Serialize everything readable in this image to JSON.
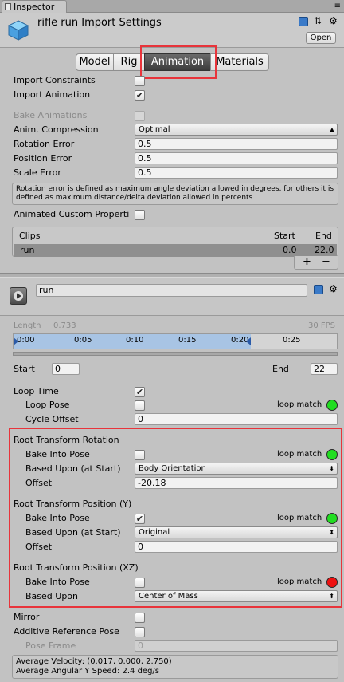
{
  "window": {
    "tab_label": "Inspector"
  },
  "header": {
    "title": "rifle run Import Settings",
    "open_button": "Open"
  },
  "tabs": [
    {
      "label": "Model"
    },
    {
      "label": "Rig"
    },
    {
      "label": "Animation",
      "active": true
    },
    {
      "label": "Materials"
    }
  ],
  "import": {
    "constraints_label": "Import Constraints",
    "constraints_checked": false,
    "animation_label": "Import Animation",
    "animation_checked": true,
    "bake_label": "Bake Animations",
    "bake_checked": false,
    "compression_label": "Anim. Compression",
    "compression_value": "Optimal",
    "rotation_error_label": "Rotation Error",
    "rotation_error_value": "0.5",
    "position_error_label": "Position Error",
    "position_error_value": "0.5",
    "scale_error_label": "Scale Error",
    "scale_error_value": "0.5",
    "help_text": "Rotation error is defined as maximum angle deviation allowed in degrees, for others it is defined as maximum distance/delta deviation allowed in percents",
    "custom_props_label": "Animated Custom Properti",
    "custom_props_checked": false
  },
  "clips": {
    "headers": {
      "name": "Clips",
      "start": "Start",
      "end": "End"
    },
    "rows": [
      {
        "name": "run",
        "start": "0.0",
        "end": "22.0"
      }
    ],
    "add": "+",
    "remove": "−"
  },
  "clip": {
    "name": "run",
    "length_label": "Length",
    "length_value": "0.733",
    "fps": "30 FPS",
    "timeline_ticks": [
      "0:00",
      "0:05",
      "0:10",
      "0:15",
      "0:20",
      "0:25"
    ],
    "start_label": "Start",
    "start_value": "0",
    "end_label": "End",
    "end_value": "22"
  },
  "loop": {
    "time_label": "Loop Time",
    "time_checked": true,
    "pose_label": "Loop Pose",
    "pose_checked": false,
    "pose_match_label": "loop match",
    "pose_match_color": "#22dd22",
    "cycle_label": "Cycle Offset",
    "cycle_value": "0"
  },
  "root_rotation": {
    "title": "Root Transform Rotation",
    "bake_label": "Bake Into Pose",
    "bake_checked": false,
    "match_label": "loop match",
    "match_color": "#22dd22",
    "based_label": "Based Upon (at Start)",
    "based_value": "Body Orientation",
    "offset_label": "Offset",
    "offset_value": "-20.18"
  },
  "root_position_y": {
    "title": "Root Transform Position (Y)",
    "bake_label": "Bake Into Pose",
    "bake_checked": true,
    "match_label": "loop match",
    "match_color": "#22dd22",
    "based_label": "Based Upon (at Start)",
    "based_value": "Original",
    "offset_label": "Offset",
    "offset_value": "0"
  },
  "root_position_xz": {
    "title": "Root Transform Position (XZ)",
    "bake_label": "Bake Into Pose",
    "bake_checked": false,
    "match_label": "loop match",
    "match_color": "#ee1111",
    "based_label": "Based Upon",
    "based_value": "Center of Mass"
  },
  "misc": {
    "mirror_label": "Mirror",
    "mirror_checked": false,
    "additive_label": "Additive Reference Pose",
    "additive_checked": false,
    "pose_frame_label": "Pose Frame",
    "pose_frame_value": "0"
  },
  "footer": {
    "velocity": "Average Velocity: (0.017, 0.000, 2.750)",
    "angular": "Average Angular Y Speed: 2.4 deg/s"
  },
  "colors": {
    "highlight": "#e8343b",
    "match_green": "#22dd22",
    "match_red": "#ee1111"
  }
}
